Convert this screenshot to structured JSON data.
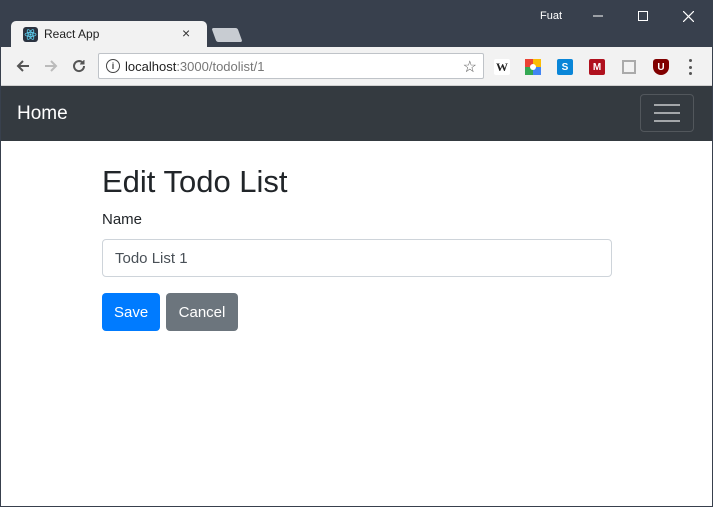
{
  "window": {
    "user": "Fuat",
    "controls": {
      "minimize": "—",
      "maximize": "☐",
      "close": "✕"
    }
  },
  "browser": {
    "tab": {
      "title": "React App",
      "close": "×",
      "favicon": "react-logo-icon"
    },
    "toolbar": {
      "url_host": "localhost",
      "url_rest": ":3000/todolist/1",
      "extensions": [
        {
          "name": "wikipedia-extension-icon",
          "glyph": "W",
          "color": "#ffffff"
        },
        {
          "name": "google-extension-icon",
          "glyph": "",
          "color": "#4285f4"
        },
        {
          "name": "skype-extension-icon",
          "glyph": "S",
          "color": "#0a86d8"
        },
        {
          "name": "mendeley-extension-icon",
          "glyph": "M",
          "color": "#b0111e"
        },
        {
          "name": "save-page-extension-icon",
          "glyph": "",
          "color": "#cccccc"
        },
        {
          "name": "ublock-extension-icon",
          "glyph": "U",
          "color": "#800000"
        }
      ]
    }
  },
  "navbar": {
    "brand": "Home"
  },
  "form": {
    "title": "Edit Todo List",
    "name_label": "Name",
    "name_value": "Todo List 1",
    "save_label": "Save",
    "cancel_label": "Cancel"
  },
  "colors": {
    "primary": "#007bff",
    "secondary": "#6c757d",
    "navbar": "#343a40",
    "titlebar": "#38404d"
  }
}
